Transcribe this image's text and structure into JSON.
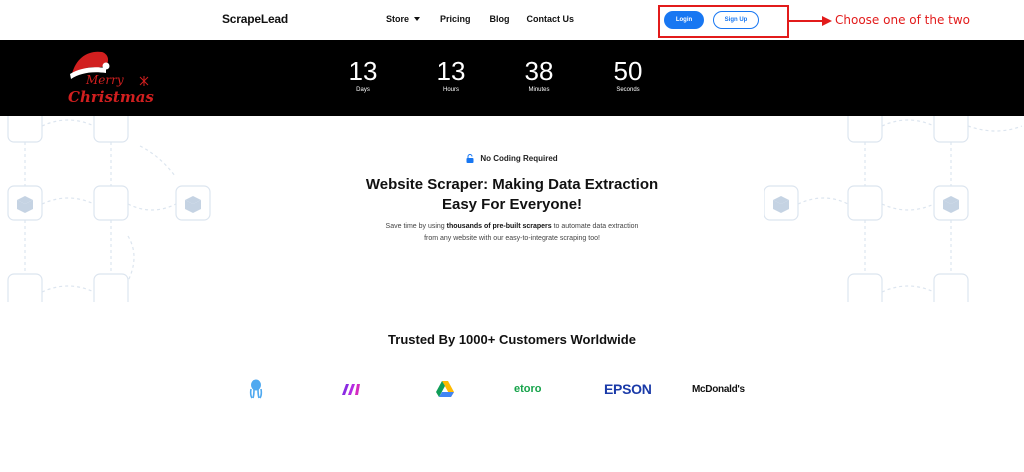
{
  "header": {
    "logo": "ScrapeLead",
    "nav": [
      {
        "label": "Store",
        "has_dropdown": true
      },
      {
        "label": "Pricing"
      },
      {
        "label": "Blog"
      },
      {
        "label": "Contact Us"
      }
    ],
    "login_label": "Login",
    "signup_label": "Sign Up"
  },
  "annotation": {
    "text": "Choose one of the two",
    "color": "#e21b1b"
  },
  "banner": {
    "seasonal_graphic": "merry-christmas-santa-hat",
    "seasonal_text_1": "Merry",
    "seasonal_text_2": "Christmas",
    "countdown": [
      {
        "value": "13",
        "unit": "Days"
      },
      {
        "value": "13",
        "unit": "Hours"
      },
      {
        "value": "38",
        "unit": "Minutes"
      },
      {
        "value": "50",
        "unit": "Seconds"
      }
    ]
  },
  "hero": {
    "badge_icon": "unlock-icon",
    "badge": "No Coding Required",
    "title_line1": "Website Scraper: Making Data Extraction",
    "title_line2": "Easy For Everyone!",
    "desc_pre": "Save time by using ",
    "desc_bold": "thousands of pre-built scrapers",
    "desc_post": " to automate data extraction",
    "desc_line2": "from any website with our easy-to-integrate scraping too!"
  },
  "trusted": {
    "title": "Trusted By 1000+ Customers Worldwide",
    "logos": [
      {
        "name": "octopus-logo"
      },
      {
        "name": "make-logo"
      },
      {
        "name": "google-drive-logo"
      },
      {
        "name": "etoro",
        "text": "etoro"
      },
      {
        "name": "epson",
        "text": "EPSON"
      },
      {
        "name": "mcdonalds",
        "text": "McDonald's"
      }
    ]
  },
  "colors": {
    "primary": "#1877f2",
    "banner_bg": "#000000",
    "annotation_red": "#e21b1b"
  }
}
